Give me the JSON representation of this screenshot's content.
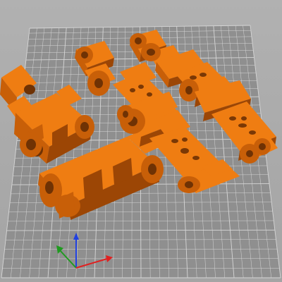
{
  "viewer": {
    "view_mode": "3d-perspective",
    "bed": {
      "grid_color": "#d6d6d6",
      "bed_color": "#8f8f8f"
    },
    "part_color": "#ef7d12",
    "parts": [
      {
        "id": "chain-end-bracket-left"
      },
      {
        "id": "chain-end-bracket-middle"
      },
      {
        "id": "chain-end-bracket-front"
      },
      {
        "id": "link-small-1"
      },
      {
        "id": "link-small-2"
      },
      {
        "id": "link-plate-1"
      },
      {
        "id": "link-plate-2"
      },
      {
        "id": "link-plate-3"
      },
      {
        "id": "link-plate-4"
      },
      {
        "id": "link-plate-5"
      }
    ],
    "axes": {
      "x_color": "#e02020",
      "y_color": "#1f9a1f",
      "z_color": "#2040e0"
    }
  }
}
